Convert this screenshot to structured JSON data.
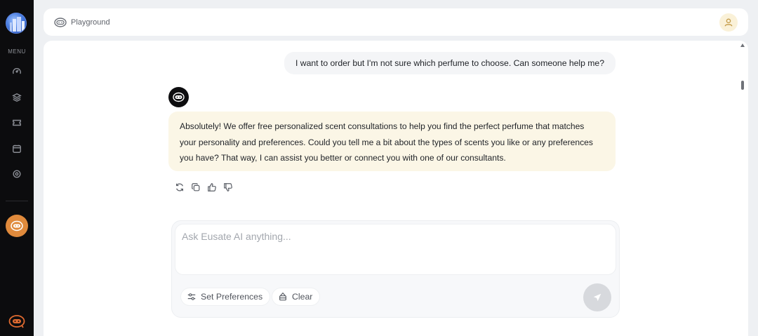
{
  "sidebar": {
    "logo_icon": "building-logo-icon",
    "menu_label": "MENU",
    "items": [
      {
        "name": "dashboard-icon"
      },
      {
        "name": "layers-icon"
      },
      {
        "name": "ticket-icon"
      },
      {
        "name": "calendar-icon"
      },
      {
        "name": "settings-icon"
      }
    ],
    "bot_button_icon": "chatbot-icon",
    "bottom_logo_icon": "chatbot-logo-icon",
    "accent_color": "#e08a3c"
  },
  "topbar": {
    "icon": "chatbot-outline-icon",
    "title": "Playground",
    "avatar_icon": "user-icon"
  },
  "chat": {
    "user_message": "I want to order but I'm not sure which perfume to choose. Can someone help me?",
    "ai_message_lines": [
      "Absolutely! We offer free personalized scent consultations to help you find the perfect perfume that matches",
      "your personality and preferences. Could you tell me a bit about the types of scents you like or any preferences",
      "you have? That way, I can assist you better or connect you with one of our consultants."
    ],
    "actions": [
      "refresh-icon",
      "copy-icon",
      "thumbs-up-icon",
      "thumbs-down-icon"
    ]
  },
  "composer": {
    "placeholder": "Ask Eusate AI anything...",
    "value": "",
    "set_preferences_label": "Set Preferences",
    "clear_label": "Clear",
    "send_icon": "send-icon"
  }
}
